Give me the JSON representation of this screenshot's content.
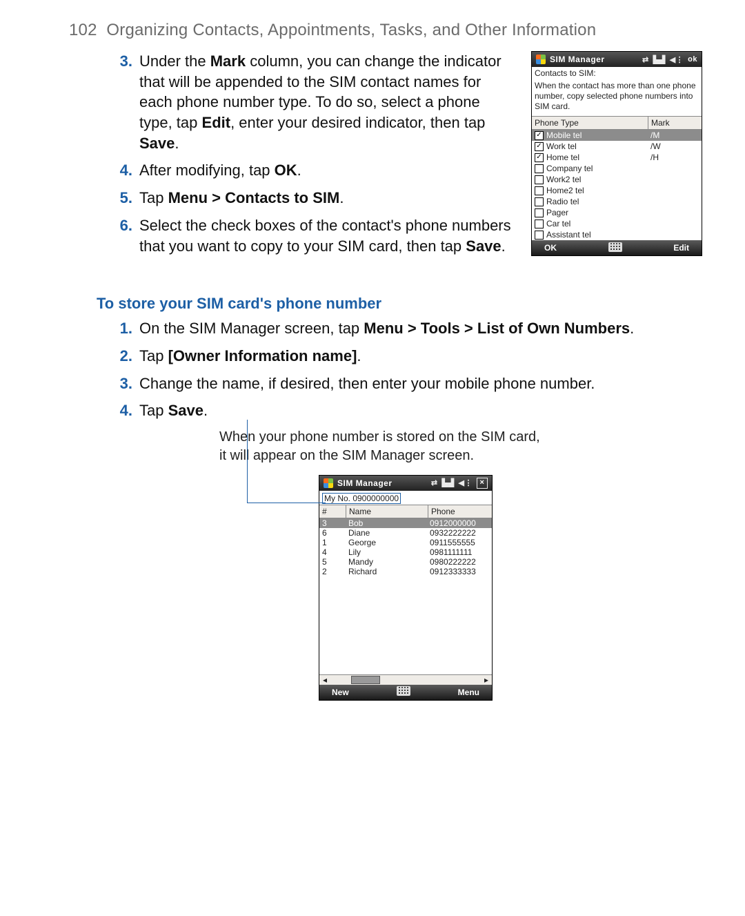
{
  "header": {
    "page_number": "102",
    "chapter_title": "Organizing Contacts, Appointments, Tasks, and Other Information"
  },
  "section1_steps": [
    {
      "n": "3.",
      "html": "Under the <b>Mark</b> column, you can change the indicator that will be appended to the SIM contact names for each phone number type. To do so, select a phone type, tap <b>Edit</b>, enter your desired indicator, then tap <b>Save</b>."
    },
    {
      "n": "4.",
      "html": "After modifying, tap <b>OK</b>."
    },
    {
      "n": "5.",
      "html": "Tap <b>Menu &gt; Contacts to SIM</b>."
    },
    {
      "n": "6.",
      "html": "Select the check boxes of the contact's phone numbers that you want to copy to your SIM card, then tap <b>Save</b>."
    }
  ],
  "screenshot1": {
    "title": "SIM Manager",
    "titlebar_ok": "ok",
    "label": "Contacts to SIM:",
    "help": "When the contact has more than one phone number, copy selected phone numbers into SIM card.",
    "head_col1": "Phone Type",
    "head_col2": "Mark",
    "rows": [
      {
        "name": "Mobile tel",
        "mark": "/M",
        "checked": true,
        "selected": true
      },
      {
        "name": "Work tel",
        "mark": "/W",
        "checked": true
      },
      {
        "name": "Home tel",
        "mark": "/H",
        "checked": true
      },
      {
        "name": "Company tel",
        "mark": "",
        "checked": false
      },
      {
        "name": "Work2 tel",
        "mark": "",
        "checked": false
      },
      {
        "name": "Home2 tel",
        "mark": "",
        "checked": false
      },
      {
        "name": "Radio tel",
        "mark": "",
        "checked": false
      },
      {
        "name": "Pager",
        "mark": "",
        "checked": false
      },
      {
        "name": "Car tel",
        "mark": "",
        "checked": false
      },
      {
        "name": "Assistant tel",
        "mark": "",
        "checked": false
      }
    ],
    "soft_left": "OK",
    "soft_right": "Edit"
  },
  "section2_heading": "To store your SIM card's phone number",
  "section2_steps": [
    {
      "n": "1.",
      "html": "On the SIM Manager screen, tap <b>Menu &gt; Tools &gt; List of Own Numbers</b>."
    },
    {
      "n": "2.",
      "html": "Tap <b>[Owner Information name]</b>."
    },
    {
      "n": "3.",
      "html": "Change the name, if desired, then enter your mobile phone number."
    },
    {
      "n": "4.",
      "html": "Tap <b>Save</b>."
    }
  ],
  "caption_line1": "When your phone number is stored on the SIM card,",
  "caption_line2": "it will appear on the SIM Manager screen.",
  "screenshot2": {
    "title": "SIM Manager",
    "my_number": "My No. 0900000000",
    "head_c1": "#",
    "head_c2": "Name",
    "head_c3": "Phone",
    "rows": [
      {
        "n": "3",
        "name": "Bob",
        "phone": "0912000000",
        "selected": true
      },
      {
        "n": "6",
        "name": "Diane",
        "phone": "0932222222"
      },
      {
        "n": "1",
        "name": "George",
        "phone": "0911555555"
      },
      {
        "n": "4",
        "name": "Lily",
        "phone": "0981111111"
      },
      {
        "n": "5",
        "name": "Mandy",
        "phone": "0980222222"
      },
      {
        "n": "2",
        "name": "Richard",
        "phone": "0912333333"
      }
    ],
    "soft_left": "New",
    "soft_right": "Menu"
  }
}
